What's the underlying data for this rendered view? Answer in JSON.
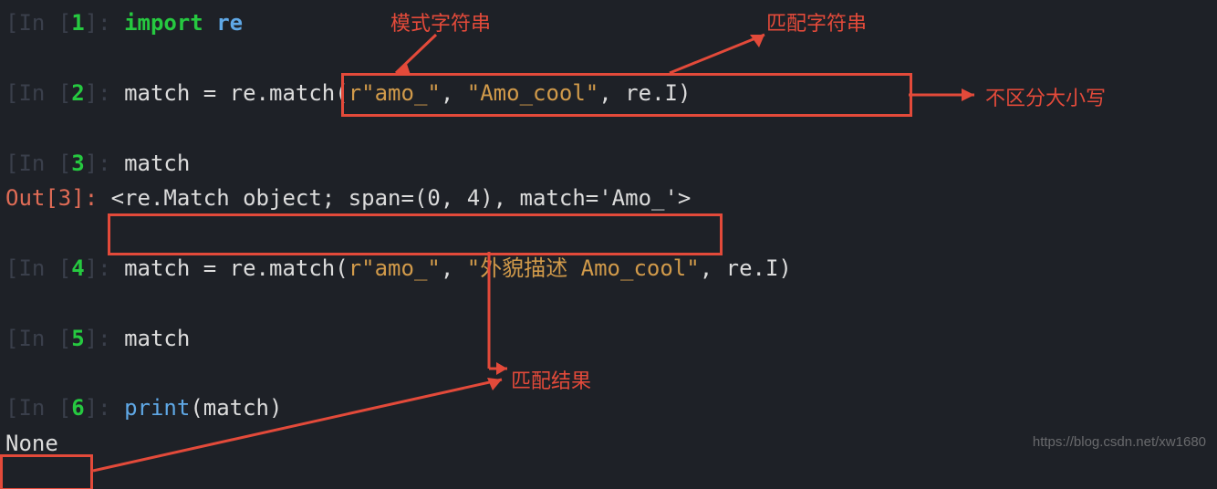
{
  "lines": {
    "l1": {
      "label_open": "[In [",
      "num": "1",
      "label_close": "]: ",
      "kw": "import ",
      "mod": "re"
    },
    "l2": {
      "label_open": "[In [",
      "num": "2",
      "label_close": "]: ",
      "var": "match = re.match",
      "paren_open": "(",
      "raw": "r\"amo_\"",
      "comma1": ", ",
      "str": "\"Amo_cool\"",
      "comma2": ", re.I",
      "paren_close": ")"
    },
    "l3": {
      "label_open": "[In [",
      "num": "3",
      "label_close": "]: ",
      "var": "match"
    },
    "l3o": {
      "label": "Out[",
      "num": "3",
      "label_close": "]: ",
      "out": "<re.Match object; span=(0, 4), match='Amo_'>"
    },
    "l4": {
      "label_open": "[In [",
      "num": "4",
      "label_close": "]: ",
      "var": "match = re.match(",
      "raw": "r\"amo_\"",
      "comma1": ", ",
      "str": "\"外貌描述 Amo_cool\"",
      "tail": ", re.I)"
    },
    "l5": {
      "label_open": "[In [",
      "num": "5",
      "label_close": "]: ",
      "var": "match"
    },
    "l6": {
      "label_open": "[In [",
      "num": "6",
      "label_close": "]: ",
      "fn": "print",
      "arg": "(match)"
    },
    "none": "None"
  },
  "annotations": {
    "pattern_str": "模式字符串",
    "match_str": "匹配字符串",
    "case_insensitive": "不区分大小写",
    "match_result": "匹配结果"
  },
  "watermark": "https://blog.csdn.net/xw1680"
}
